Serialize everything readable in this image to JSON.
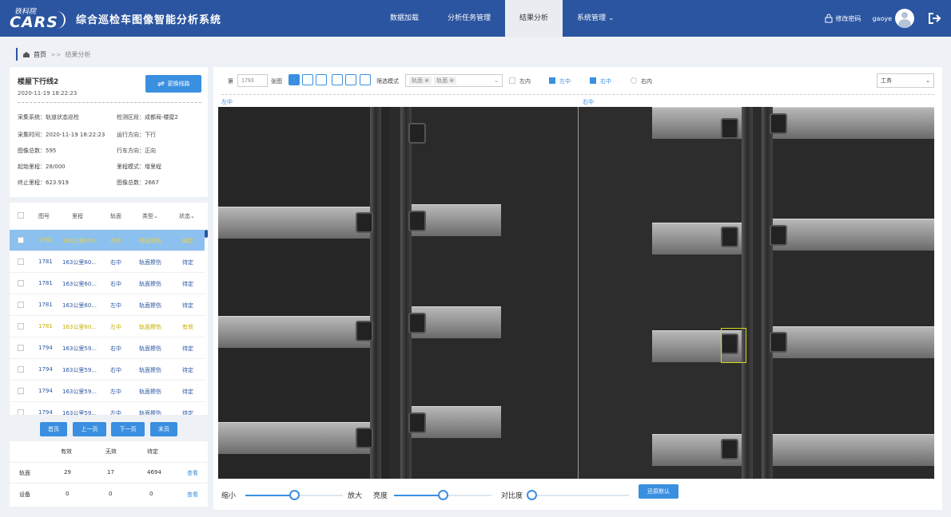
{
  "header": {
    "logo_cn": "铁科院",
    "logo_en": "CARS",
    "app_title": "综合巡检车图像智能分析系统",
    "nav": [
      "数据加载",
      "分析任务管理",
      "结果分析",
      "系统管理"
    ],
    "active_nav": "结果分析",
    "change_password": "修改密码",
    "username": "gaoye",
    "colors": {
      "primary": "#2b55a0",
      "accent": "#3a8fe0",
      "selected_row": "#8cc0ee"
    }
  },
  "breadcrumb": {
    "home": "首页",
    "separator": ">>",
    "current": "结果分析"
  },
  "info": {
    "line_title": "楼屋下行线2",
    "datetime": "2020-11-19 18:22:23",
    "change_line_button": "更换线路",
    "fields": {
      "system": "采集系统：轨道状态巡检",
      "section": "检测区段：成都局-楼屋2",
      "time": "采集时间：2020-11-19 18:22:23",
      "direction": "运行方向：下行",
      "total": "图像总数：595",
      "run_dir": "行车方向：正向",
      "start_km": "起始里程：28/000",
      "mode": "里程模式：增里程",
      "end_km": "终止里程：623.919",
      "images": "图像总数：2667"
    }
  },
  "table": {
    "headers": [
      "图号",
      "里程",
      "轨面",
      "类型",
      "状态"
    ],
    "rows": [
      {
        "no": "1781",
        "km": "163公里650...",
        "pos": "左中",
        "type": "轨面擦伤",
        "status": "确定",
        "style": "sel"
      },
      {
        "no": "1781",
        "km": "163公里60...",
        "pos": "右中",
        "type": "轨面擦伤",
        "status": "待定",
        "style": "blue"
      },
      {
        "no": "1781",
        "km": "163公里60...",
        "pos": "右中",
        "type": "轨面擦伤",
        "status": "待定",
        "style": "blue"
      },
      {
        "no": "1781",
        "km": "163公里60...",
        "pos": "左中",
        "type": "轨面擦伤",
        "status": "待定",
        "style": "blue"
      },
      {
        "no": "1781",
        "km": "163公里60...",
        "pos": "左中",
        "type": "轨面擦伤",
        "status": "有效",
        "style": "yellow"
      },
      {
        "no": "1794",
        "km": "163公里59...",
        "pos": "右中",
        "type": "轨面擦伤",
        "status": "待定",
        "style": "blue"
      },
      {
        "no": "1794",
        "km": "163公里59...",
        "pos": "右中",
        "type": "轨面擦伤",
        "status": "待定",
        "style": "blue"
      },
      {
        "no": "1794",
        "km": "163公里59...",
        "pos": "左中",
        "type": "轨面擦伤",
        "status": "待定",
        "style": "blue"
      },
      {
        "no": "1794",
        "km": "163公里59...",
        "pos": "左中",
        "type": "轨面擦伤",
        "status": "待定",
        "style": "blue"
      }
    ]
  },
  "pager": [
    "首页",
    "上一页",
    "下一页",
    "末页"
  ],
  "stats": {
    "headers": [
      "有效",
      "无效",
      "待定"
    ],
    "rows": [
      {
        "label": "轨面",
        "valid": "29",
        "invalid": "17",
        "pending": "4694",
        "link": "查看"
      },
      {
        "label": "设备",
        "valid": "0",
        "invalid": "0",
        "pending": "0",
        "link": "查看"
      }
    ]
  },
  "viewer": {
    "page_label": "第",
    "page_value": "1793",
    "page_unit": "张图",
    "filter_label": "筛选模式",
    "filter_tags": [
      "轨面 ⊗",
      "轨面 ⊗"
    ],
    "checkboxes": [
      {
        "label": "左内",
        "checked": false
      },
      {
        "label": "左中",
        "checked": true
      },
      {
        "label": "右中",
        "checked": true
      },
      {
        "label": "右内",
        "checked": false
      }
    ],
    "select_value": "工务",
    "image_labels": [
      "左中",
      "右中"
    ],
    "zoom_out": "缩小",
    "zoom_in": "放大",
    "brightness": "亮度",
    "contrast": "对比度",
    "reset_button": "还原默认",
    "zoom_level": 0.5,
    "brightness_level": 0.5,
    "contrast_level": 0.0
  }
}
